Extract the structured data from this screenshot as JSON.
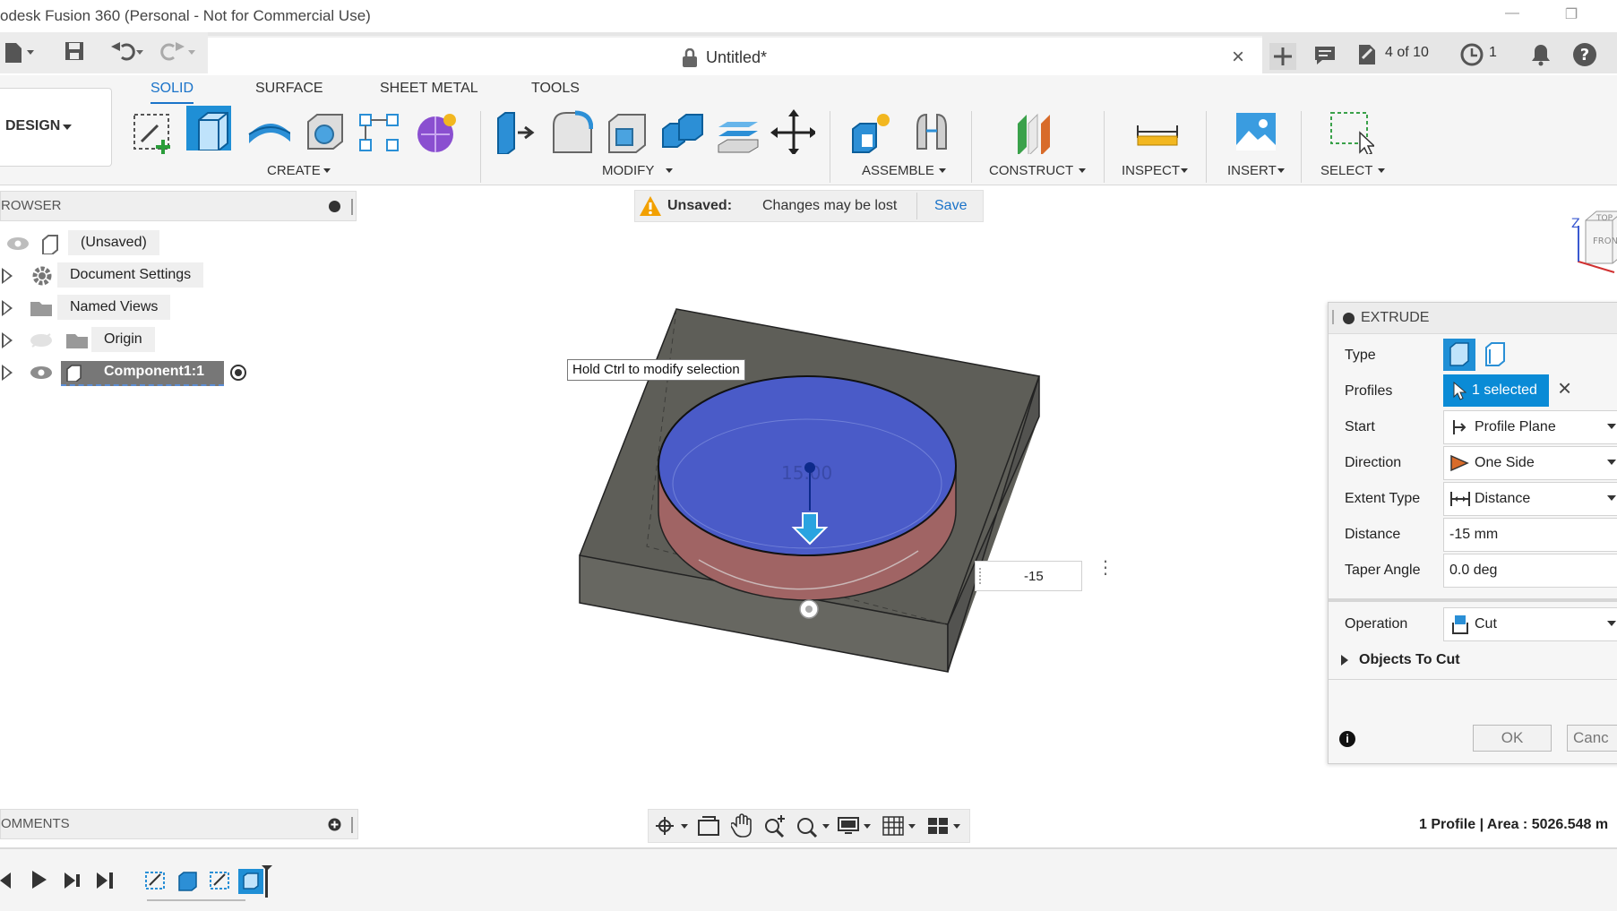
{
  "window": {
    "title": "odesk Fusion 360 (Personal - Not for Commercial Use)"
  },
  "doc_tab": {
    "title": "Untitled*",
    "jobs": "4 of 10",
    "clock_count": "1"
  },
  "ribbon": {
    "tabs": [
      "SOLID",
      "SURFACE",
      "SHEET METAL",
      "TOOLS"
    ],
    "workspace": "DESIGN",
    "groups": [
      "CREATE",
      "MODIFY",
      "ASSEMBLE",
      "CONSTRUCT",
      "INSPECT",
      "INSERT",
      "SELECT"
    ]
  },
  "browser": {
    "title": "ROWSER",
    "items": [
      {
        "label": "(Unsaved)"
      },
      {
        "label": "Document Settings"
      },
      {
        "label": "Named Views"
      },
      {
        "label": "Origin"
      },
      {
        "label": "Component1:1"
      }
    ]
  },
  "banner": {
    "title": "Unsaved:",
    "message": "Changes may be lost",
    "save_label": "Save"
  },
  "viewport": {
    "tooltip": "Hold Ctrl to modify selection",
    "dim_label": "15.00",
    "distance_input": "-15",
    "viewcube_top": "TOP",
    "viewcube_front": "FRONT",
    "axis_z": "Z"
  },
  "extrude": {
    "title": "EXTRUDE",
    "type_label": "Type",
    "profiles_label": "Profiles",
    "profiles_value": "1 selected",
    "start_label": "Start",
    "start_value": "Profile Plane",
    "direction_label": "Direction",
    "direction_value": "One Side",
    "extent_label": "Extent Type",
    "extent_value": "Distance",
    "distance_label": "Distance",
    "distance_value": "-15 mm",
    "taper_label": "Taper Angle",
    "taper_value": "0.0 deg",
    "operation_label": "Operation",
    "operation_value": "Cut",
    "objects_label": "Objects To Cut",
    "ok_label": "OK",
    "cancel_label": "Canc"
  },
  "comments": {
    "title": "OMMENTS"
  },
  "status": {
    "text": "1 Profile | Area : 5026.548 m"
  },
  "colors": {
    "accent": "#1a73c9",
    "selected_fill": "#0a8bd6",
    "body": "#5e5e58",
    "cut_face": "#4a5bc8",
    "cut_wall": "#a86060"
  }
}
